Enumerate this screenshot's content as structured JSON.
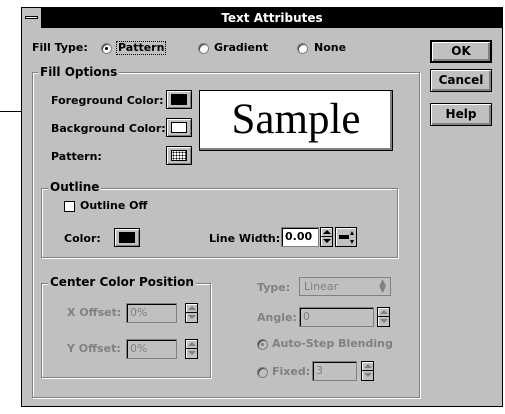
{
  "window": {
    "title": "Text Attributes"
  },
  "fill_type": {
    "label": "Fill Type:",
    "options": [
      {
        "label": "Pattern",
        "selected": true
      },
      {
        "label": "Gradient",
        "selected": false
      },
      {
        "label": "None",
        "selected": false
      }
    ]
  },
  "buttons": {
    "ok": "OK",
    "cancel": "Cancel",
    "help": "Help"
  },
  "fill_options": {
    "legend": "Fill Options",
    "foreground_label": "Foreground Color:",
    "background_label": "Background Color:",
    "pattern_label": "Pattern:",
    "foreground_color": "#000000",
    "background_color": "#ffffff",
    "sample_text": "Sample"
  },
  "outline": {
    "legend": "Outline",
    "outline_off_label": "Outline Off",
    "outline_off_checked": false,
    "color_label": "Color:",
    "color": "#000000",
    "line_width_label": "Line Width:",
    "line_width_value": "0.00"
  },
  "center_color_position": {
    "legend": "Center Color Position",
    "x_offset_label": "X Offset:",
    "x_offset_value": "0%",
    "y_offset_label": "Y Offset:",
    "y_offset_value": "0%"
  },
  "gradient": {
    "type_label": "Type:",
    "type_value": "Linear",
    "angle_label": "Angle:",
    "angle_value": "0",
    "auto_step_label": "Auto-Step Blending",
    "fixed_label": "Fixed:",
    "fixed_value": "3"
  }
}
